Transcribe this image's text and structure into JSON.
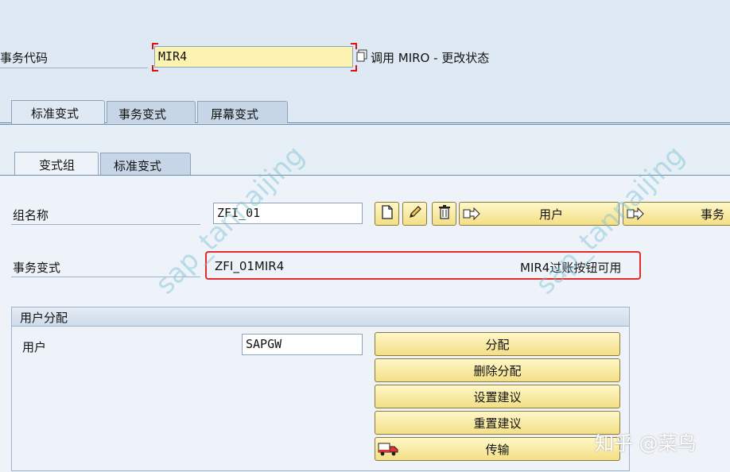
{
  "header": {
    "tcode_label": "事务代码",
    "tcode_value": "MIR4",
    "tcode_desc": "调用 MIRO - 更改状态"
  },
  "tabs_main": [
    "标准变式",
    "事务变式",
    "屏幕变式"
  ],
  "tabs_sub": [
    "变式组",
    "标准变式"
  ],
  "group_name": {
    "label": "组名称",
    "value": "ZFI_01"
  },
  "toolbar": {
    "user_label": "用户",
    "transaction_label": "事务"
  },
  "transaction_variant": {
    "label": "事务变式",
    "value": "ZFI_01MIR4",
    "desc": "MIR4过账按钮可用"
  },
  "user_assignment": {
    "title": "用户分配",
    "user_label": "用户",
    "user_value": "SAPGW",
    "buttons": [
      "分配",
      "删除分配",
      "设置建议",
      "重置建议",
      "传输"
    ]
  },
  "watermark_text": "sap_tannaijing",
  "source_mark": "知乎 @菜鸟",
  "colors": {
    "highlight_box": "#e32b2b",
    "button_fill": "#f3df86",
    "background": "#dfe9f3"
  }
}
